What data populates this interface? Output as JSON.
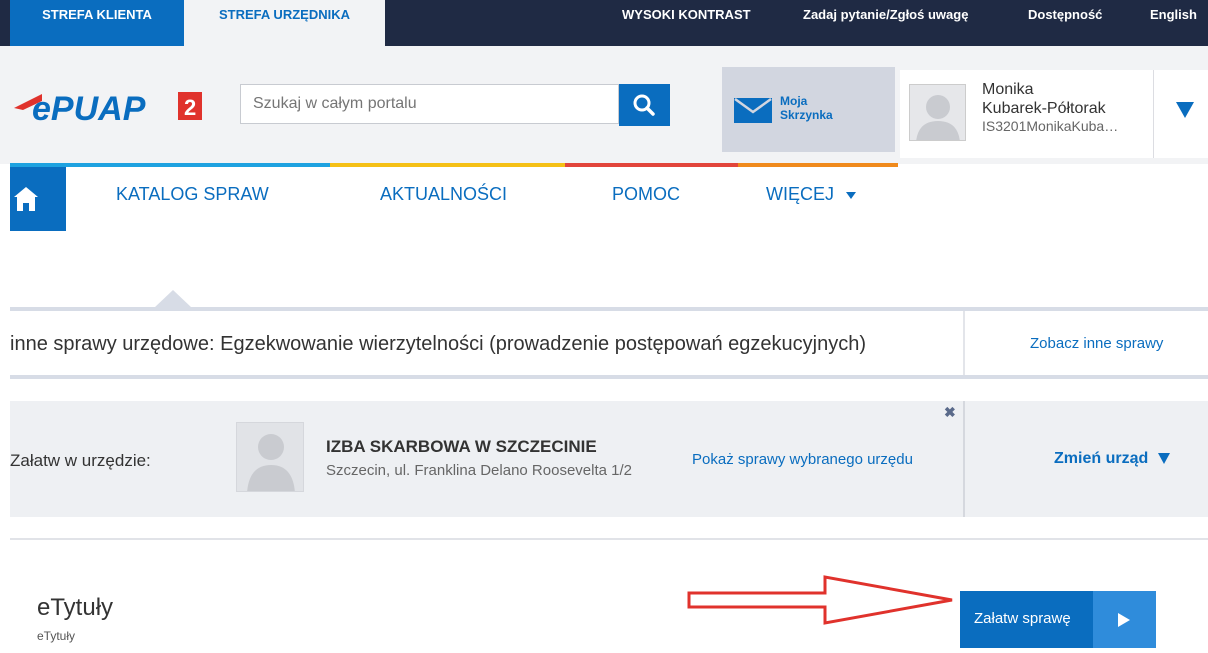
{
  "topbar": {
    "tab_client": "STREFA KLIENTA",
    "tab_official": "STREFA URZĘDNIKA",
    "high_contrast": "WYSOKI KONTRAST",
    "ask_question": "Zadaj pytanie/Zgłoś uwagę",
    "accessibility": "Dostępność",
    "language": "English"
  },
  "header": {
    "logo_text": "ePUAP",
    "logo_badge": "2",
    "search_placeholder": "Szukaj w całym portalu",
    "mailbox_label_line1": "Moja",
    "mailbox_label_line2": "Skrzynka",
    "user_name_line1": "Monika",
    "user_name_line2": "Kubarek-Półtorak",
    "user_id": "IS3201MonikaKuba…"
  },
  "colors": {
    "accent_blue": "#0a6dbf",
    "stripe_blue": "#1ea2e0",
    "stripe_yellow": "#f5c016",
    "stripe_red": "#e2453b",
    "stripe_orange": "#f08a1c",
    "logo_red": "#e0322c"
  },
  "nav": {
    "items": [
      "KATALOG SPRAW",
      "AKTUALNOŚCI",
      "POMOC",
      "WIĘCEJ"
    ]
  },
  "breadcrumb": {
    "case_title": "inne sprawy urzędowe: Egzekwowanie wierzytelności (prowadzenie postępowań egzekucyjnych)",
    "see_other": "Zobacz inne sprawy"
  },
  "office": {
    "settle_in_label": "Załatw w urzędzie:",
    "name": "IZBA SKARBOWA W SZCZECINIE",
    "address": "Szczecin, ul. Franklina Delano Roosevelta 1/2",
    "show_cases": "Pokaż sprawy wybranego urzędu",
    "close": "✖",
    "change_office": "Zmień urząd"
  },
  "service": {
    "title": "eTytuły",
    "subtitle": "eTytuły",
    "settle_button": "Załatw sprawę"
  },
  "icons": [
    "home-icon",
    "search-icon",
    "mail-icon",
    "user-avatar-icon",
    "dropdown-caret-icon",
    "play-icon",
    "close-icon",
    "red-arrow-annotation"
  ]
}
